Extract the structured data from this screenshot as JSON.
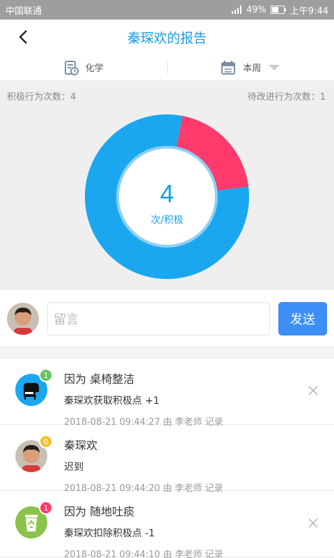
{
  "status_bar": {
    "carrier": "中国联通",
    "battery": "49%",
    "time": "上午9:44"
  },
  "header": {
    "title": "秦琛欢的报告"
  },
  "filters": {
    "subject": "化学",
    "period": "本周"
  },
  "stats": {
    "positive_label": "积极行为次数：4",
    "improve_label": "待改进行为次数：1",
    "center_value": "4",
    "center_unit": "次/积极"
  },
  "chart_data": {
    "type": "pie",
    "values": [
      4,
      1
    ],
    "colors": [
      "#1aa7ef",
      "#fe3b6a"
    ]
  },
  "comment": {
    "placeholder": "留言",
    "send_label": "发送"
  },
  "records": [
    {
      "title": "因为 桌椅整洁",
      "detail": "秦琛欢获取积极点 +1",
      "meta": "2018-08-21 09:44:27 由 李老师 记录",
      "badge": "1",
      "badge_color": "#62c55d",
      "icon": "piano-icon",
      "closable": true
    },
    {
      "title": "秦琛欢",
      "detail": "迟到",
      "meta": "2018-08-21 09:44:20 由 李老师 记录",
      "badge": "0",
      "badge_color": "#f5c032",
      "icon": "avatar",
      "closable": false
    },
    {
      "title": "因为 随地吐痰",
      "detail": "秦琛欢扣除积极点 -1",
      "meta": "2018-08-21 09:44:10 由 李老师 记录",
      "badge": "1",
      "badge_color": "#fe3b6a",
      "icon": "recycle-icon",
      "closable": true
    }
  ]
}
